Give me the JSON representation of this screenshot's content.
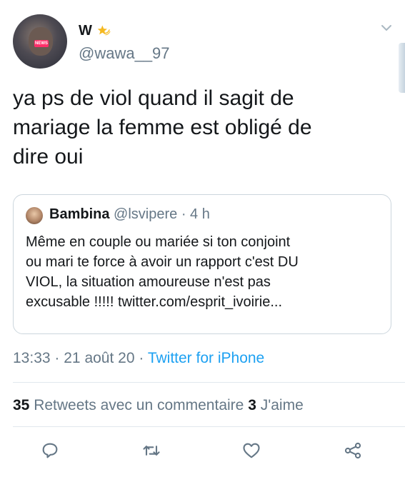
{
  "author": {
    "name": "W",
    "handle": "@wawa__97",
    "avatar_badge": "NEWS"
  },
  "tweet": {
    "text": "ya ps de viol quand il sagit de\nmariage la femme est obligé de\ndire oui"
  },
  "quoted_tweet": {
    "name": "Bambina",
    "handle": "@lsvipere",
    "separator": "·",
    "time": "4 h",
    "text": "Même en couple ou mariée si ton conjoint\nou mari te force à avoir un rapport c'est DU\nVIOL, la situation amoureuse n'est pas\nexcusable !!!!! twitter.com/esprit_ivoirie..."
  },
  "meta": {
    "time": "13:33",
    "separator": "·",
    "date": "21 août 20",
    "source": "Twitter for iPhone"
  },
  "stats": {
    "retweets_count": "35",
    "retweets_label": "Retweets avec un commentaire",
    "likes_count": "3",
    "likes_label": "J'aime"
  },
  "icons": [
    "star-icon",
    "chevron-down-icon",
    "reply-icon",
    "retweet-icon",
    "like-icon",
    "share-icon"
  ],
  "colors": {
    "text": "#14171a",
    "secondary": "#657786",
    "link": "#1da1f2",
    "star": "#f5b921",
    "border": "#ccd6dd"
  }
}
